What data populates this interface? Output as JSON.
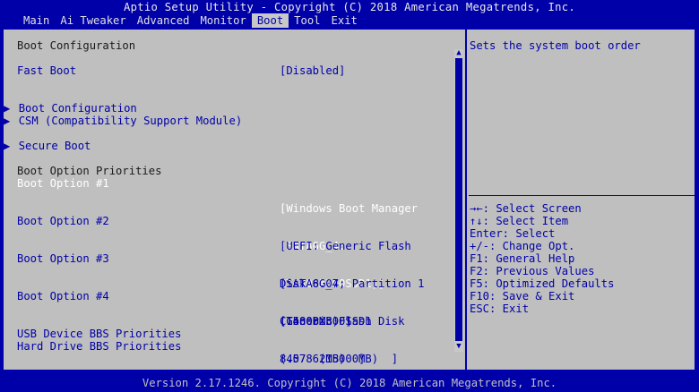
{
  "title": "Aptio Setup Utility - Copyright (C) 2018 American Megatrends, Inc.",
  "tabs": [
    "Main",
    "Ai Tweaker",
    "Advanced",
    "Monitor",
    "Boot",
    "Tool",
    "Exit"
  ],
  "active_tab": "Boot",
  "menu": {
    "heading_boot_configuration": "Boot Configuration",
    "fast_boot_label": "Fast Boot",
    "fast_boot_value": "[Disabled]",
    "submenu_boot_configuration": "Boot Configuration",
    "submenu_csm": "CSM (Compatibility Support Module)",
    "submenu_secure_boot": "Secure Boot",
    "heading_boot_option_priorities": "Boot Option Priorities",
    "boot_option_1_label": "Boot Option #1",
    "boot_option_1_value": [
      "[Windows Boot Manager",
      "(SATA6G_4:",
      "CT480BX500SSD1)]"
    ],
    "boot_option_2_label": "Boot Option #2",
    "boot_option_2_value": [
      "[UEFI: Generic Flash",
      "Disk 8.07, Partition 1",
      "(15000MB) ]"
    ],
    "boot_option_3_label": "Boot Option #3",
    "boot_option_3_value": [
      "[SATA6G_4:",
      "CT480BX500SSD1",
      "(457862MB)  ]"
    ],
    "boot_option_4_label": "Boot Option #4",
    "boot_option_4_value": [
      "[Generic Flash Disk",
      "8.07  (15000MB)  ]"
    ],
    "usb_bbs": "USB Device BBS Priorities",
    "hdd_bbs": "Hard Drive BBS Priorities",
    "submenu_marker": "▶"
  },
  "help": {
    "description": "Sets the system boot order",
    "keys": [
      "→←: Select Screen",
      "↑↓: Select Item",
      "Enter: Select",
      "+/-: Change Opt.",
      "F1: General Help",
      "F2: Previous Values",
      "F5: Optimized Defaults",
      "F10: Save & Exit",
      "ESC: Exit"
    ]
  },
  "footer": "Version 2.17.1246. Copyright (C) 2018 American Megatrends, Inc.",
  "colors": {
    "background": "#0000a8",
    "panel": "#bfbfbf",
    "highlight": "#ffffff"
  }
}
